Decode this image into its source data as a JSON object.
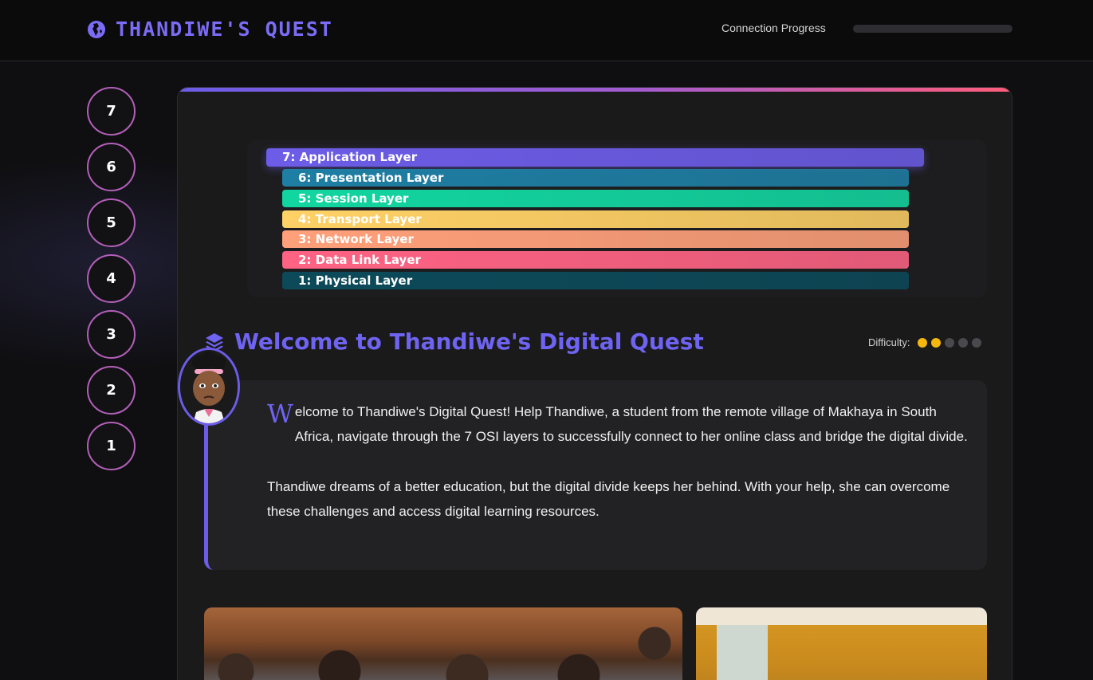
{
  "header": {
    "title": "THANDIWE'S QUEST",
    "logo_icon": "globe-africa-icon",
    "progress_label": "Connection Progress",
    "progress_value": 0
  },
  "layer_nav": [
    "7",
    "6",
    "5",
    "4",
    "3",
    "2",
    "1"
  ],
  "osi_stack": [
    {
      "label": "7: Application Layer",
      "color": "#6c5ce7"
    },
    {
      "label": "6: Presentation Layer",
      "color": "#1e7ea3"
    },
    {
      "label": "5: Session Layer",
      "color": "#12d6a0"
    },
    {
      "label": "4: Transport Layer",
      "color": "#ffd166"
    },
    {
      "label": "3: Network Layer",
      "color": "#ffa07a"
    },
    {
      "label": "2: Data Link Layer",
      "color": "#ff6384"
    },
    {
      "label": "1: Physical Layer",
      "color": "#0c4a5a"
    }
  ],
  "level": {
    "title": "Welcome to Thandiwe's Digital Quest",
    "title_icon": "layers-icon",
    "difficulty_label": "Difficulty:",
    "difficulty": 2,
    "difficulty_max": 5,
    "dropcap": "W",
    "paragraph1": "elcome to Thandiwe's Digital Quest! Help Thandiwe, a student from the remote village of Makhaya in South Africa, navigate through the 7 OSI layers to successfully connect to her online class and bridge the digital divide.",
    "paragraph2": "Thandiwe dreams of a better education, but the digital divide keeps her behind. With your help, she can overcome these challenges and access digital learning resources."
  },
  "colors": {
    "accent": "#6c5ce7",
    "difficulty_on": "#f5b70e",
    "difficulty_off": "#4a4a4e"
  }
}
